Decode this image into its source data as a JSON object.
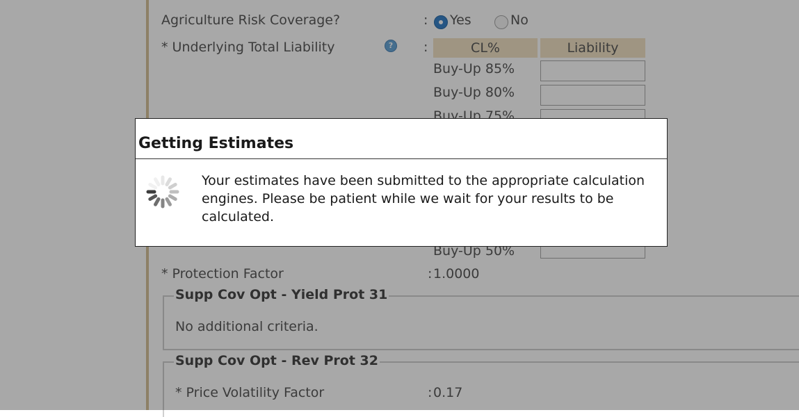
{
  "form": {
    "arc_label": "Agriculture Risk Coverage?",
    "arc_options": [
      "Yes",
      "No"
    ],
    "arc_selected": "Yes",
    "utl_label": "* Underlying Total Liability",
    "table_headers": [
      "CL%",
      "Liability"
    ],
    "coverage_levels": [
      "Buy-Up 85%",
      "Buy-Up 80%",
      "Buy-Up 75%",
      "Buy-Up 50%"
    ],
    "protection_factor_label": "* Protection Factor",
    "protection_factor_value": "1.0000",
    "yield_prot_legend": "Supp Cov Opt - Yield Prot 31",
    "yield_prot_text": "No additional criteria.",
    "rev_prot_legend": "Supp Cov Opt - Rev Prot 32",
    "price_vol_label": "* Price Volatility Factor",
    "price_vol_value": "0.17"
  },
  "dialog": {
    "title": "Getting Estimates",
    "message": "Your estimates have been submitted to the appropriate calculation engines. Please be patient while we wait for your results to be calculated."
  },
  "icons": {
    "help": "help-icon",
    "spinner": "loading-spinner-icon"
  },
  "colors": {
    "accent_blue": "#3a83c8",
    "header_tan": "#f1e3c6",
    "left_rule": "#d7c39c"
  }
}
